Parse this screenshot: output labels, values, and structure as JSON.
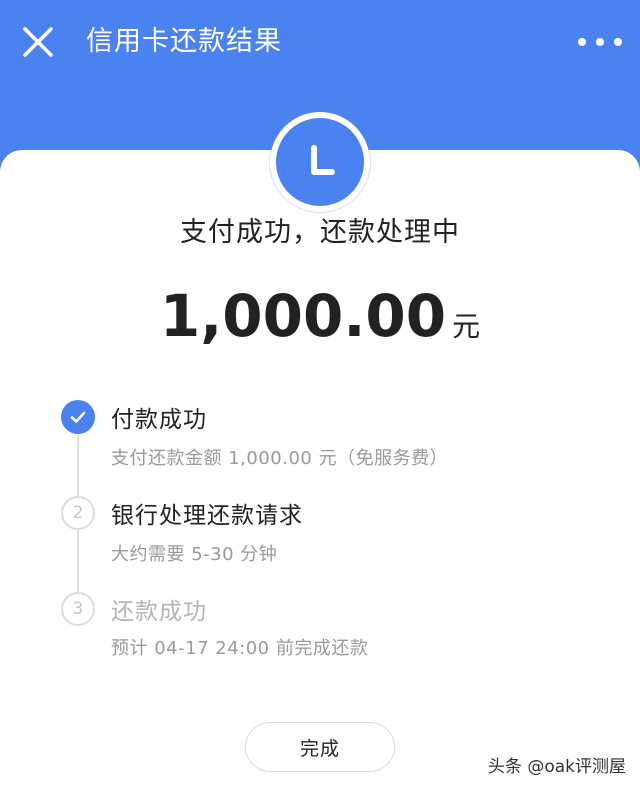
{
  "header": {
    "title": "信用卡还款结果",
    "close_icon": "close-icon",
    "more_icon": "more-horizontal-icon",
    "color": "#4a82f0"
  },
  "status": {
    "icon": "clock-icon",
    "text": "支付成功，还款处理中"
  },
  "amount": {
    "value": "1,000.00",
    "unit": "元"
  },
  "steps": [
    {
      "number": "",
      "state": "done",
      "title": "付款成功",
      "desc": "支付还款金额 1,000.00 元（免服务费）"
    },
    {
      "number": "2",
      "state": "pending",
      "title": "银行处理还款请求",
      "desc": "大约需要 5-30 分钟"
    },
    {
      "number": "3",
      "state": "pending",
      "title": "还款成功",
      "desc": "预计 04-17 24:00 前完成还款"
    }
  ],
  "actions": {
    "done_label": "完成"
  },
  "watermark": "头条 @oak评测屋"
}
